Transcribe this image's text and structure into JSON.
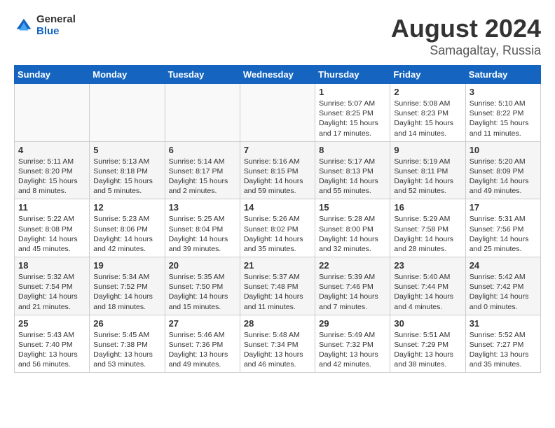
{
  "header": {
    "logo_general": "General",
    "logo_blue": "Blue",
    "main_title": "August 2024",
    "sub_title": "Samagaltay, Russia"
  },
  "days_of_week": [
    "Sunday",
    "Monday",
    "Tuesday",
    "Wednesday",
    "Thursday",
    "Friday",
    "Saturday"
  ],
  "weeks": [
    [
      {
        "day": "",
        "info": ""
      },
      {
        "day": "",
        "info": ""
      },
      {
        "day": "",
        "info": ""
      },
      {
        "day": "",
        "info": ""
      },
      {
        "day": "1",
        "info": "Sunrise: 5:07 AM\nSunset: 8:25 PM\nDaylight: 15 hours\nand 17 minutes."
      },
      {
        "day": "2",
        "info": "Sunrise: 5:08 AM\nSunset: 8:23 PM\nDaylight: 15 hours\nand 14 minutes."
      },
      {
        "day": "3",
        "info": "Sunrise: 5:10 AM\nSunset: 8:22 PM\nDaylight: 15 hours\nand 11 minutes."
      }
    ],
    [
      {
        "day": "4",
        "info": "Sunrise: 5:11 AM\nSunset: 8:20 PM\nDaylight: 15 hours\nand 8 minutes."
      },
      {
        "day": "5",
        "info": "Sunrise: 5:13 AM\nSunset: 8:18 PM\nDaylight: 15 hours\nand 5 minutes."
      },
      {
        "day": "6",
        "info": "Sunrise: 5:14 AM\nSunset: 8:17 PM\nDaylight: 15 hours\nand 2 minutes."
      },
      {
        "day": "7",
        "info": "Sunrise: 5:16 AM\nSunset: 8:15 PM\nDaylight: 14 hours\nand 59 minutes."
      },
      {
        "day": "8",
        "info": "Sunrise: 5:17 AM\nSunset: 8:13 PM\nDaylight: 14 hours\nand 55 minutes."
      },
      {
        "day": "9",
        "info": "Sunrise: 5:19 AM\nSunset: 8:11 PM\nDaylight: 14 hours\nand 52 minutes."
      },
      {
        "day": "10",
        "info": "Sunrise: 5:20 AM\nSunset: 8:09 PM\nDaylight: 14 hours\nand 49 minutes."
      }
    ],
    [
      {
        "day": "11",
        "info": "Sunrise: 5:22 AM\nSunset: 8:08 PM\nDaylight: 14 hours\nand 45 minutes."
      },
      {
        "day": "12",
        "info": "Sunrise: 5:23 AM\nSunset: 8:06 PM\nDaylight: 14 hours\nand 42 minutes."
      },
      {
        "day": "13",
        "info": "Sunrise: 5:25 AM\nSunset: 8:04 PM\nDaylight: 14 hours\nand 39 minutes."
      },
      {
        "day": "14",
        "info": "Sunrise: 5:26 AM\nSunset: 8:02 PM\nDaylight: 14 hours\nand 35 minutes."
      },
      {
        "day": "15",
        "info": "Sunrise: 5:28 AM\nSunset: 8:00 PM\nDaylight: 14 hours\nand 32 minutes."
      },
      {
        "day": "16",
        "info": "Sunrise: 5:29 AM\nSunset: 7:58 PM\nDaylight: 14 hours\nand 28 minutes."
      },
      {
        "day": "17",
        "info": "Sunrise: 5:31 AM\nSunset: 7:56 PM\nDaylight: 14 hours\nand 25 minutes."
      }
    ],
    [
      {
        "day": "18",
        "info": "Sunrise: 5:32 AM\nSunset: 7:54 PM\nDaylight: 14 hours\nand 21 minutes."
      },
      {
        "day": "19",
        "info": "Sunrise: 5:34 AM\nSunset: 7:52 PM\nDaylight: 14 hours\nand 18 minutes."
      },
      {
        "day": "20",
        "info": "Sunrise: 5:35 AM\nSunset: 7:50 PM\nDaylight: 14 hours\nand 15 minutes."
      },
      {
        "day": "21",
        "info": "Sunrise: 5:37 AM\nSunset: 7:48 PM\nDaylight: 14 hours\nand 11 minutes."
      },
      {
        "day": "22",
        "info": "Sunrise: 5:39 AM\nSunset: 7:46 PM\nDaylight: 14 hours\nand 7 minutes."
      },
      {
        "day": "23",
        "info": "Sunrise: 5:40 AM\nSunset: 7:44 PM\nDaylight: 14 hours\nand 4 minutes."
      },
      {
        "day": "24",
        "info": "Sunrise: 5:42 AM\nSunset: 7:42 PM\nDaylight: 14 hours\nand 0 minutes."
      }
    ],
    [
      {
        "day": "25",
        "info": "Sunrise: 5:43 AM\nSunset: 7:40 PM\nDaylight: 13 hours\nand 56 minutes."
      },
      {
        "day": "26",
        "info": "Sunrise: 5:45 AM\nSunset: 7:38 PM\nDaylight: 13 hours\nand 53 minutes."
      },
      {
        "day": "27",
        "info": "Sunrise: 5:46 AM\nSunset: 7:36 PM\nDaylight: 13 hours\nand 49 minutes."
      },
      {
        "day": "28",
        "info": "Sunrise: 5:48 AM\nSunset: 7:34 PM\nDaylight: 13 hours\nand 46 minutes."
      },
      {
        "day": "29",
        "info": "Sunrise: 5:49 AM\nSunset: 7:32 PM\nDaylight: 13 hours\nand 42 minutes."
      },
      {
        "day": "30",
        "info": "Sunrise: 5:51 AM\nSunset: 7:29 PM\nDaylight: 13 hours\nand 38 minutes."
      },
      {
        "day": "31",
        "info": "Sunrise: 5:52 AM\nSunset: 7:27 PM\nDaylight: 13 hours\nand 35 minutes."
      }
    ]
  ]
}
